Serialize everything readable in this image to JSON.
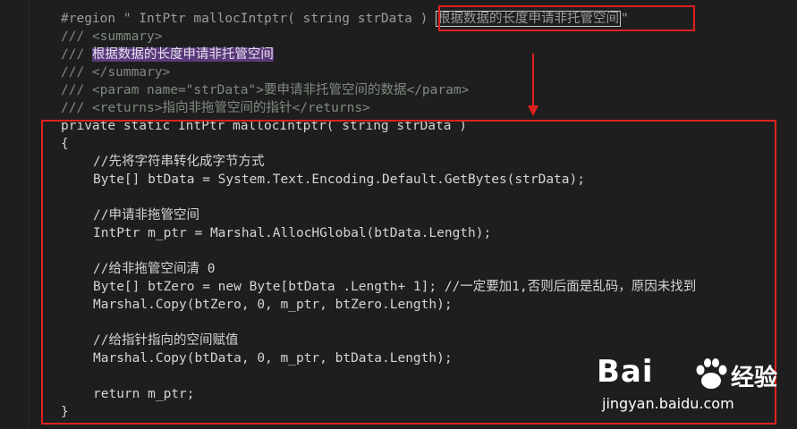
{
  "editor": {
    "lines": [
      {
        "segments": [
          {
            "t": "#region \" IntPtr mallocIntptr( string strData ) "
          },
          {
            "t": "根据数据的长度申请非托管空间",
            "boxed": true
          },
          {
            "t": "\""
          }
        ],
        "cls": "c-region"
      },
      {
        "segments": [
          {
            "t": "/// <summary>"
          }
        ],
        "cls": "c-doc"
      },
      {
        "segments": [
          {
            "t": "/// "
          },
          {
            "t": "根据数据的长度申请非托管空间",
            "hl": true
          }
        ],
        "cls": "c-doc"
      },
      {
        "segments": [
          {
            "t": "/// </summary>"
          }
        ],
        "cls": "c-doc"
      },
      {
        "segments": [
          {
            "t": "/// <param name=\"strData\">要申请非托管空间的数据</param>"
          }
        ],
        "cls": "c-doc"
      },
      {
        "segments": [
          {
            "t": "/// <returns>指向非拖管空间的指针</returns>"
          }
        ],
        "cls": "c-doc"
      },
      {
        "segments": [
          {
            "t": "private static IntPtr mallocIntptr( string strData )"
          }
        ],
        "cls": "c-code"
      },
      {
        "segments": [
          {
            "t": "{"
          }
        ],
        "cls": "c-code"
      },
      {
        "segments": [
          {
            "t": "//先将字符串转化成字节方式"
          }
        ],
        "cls": "c-cm",
        "ind": true
      },
      {
        "segments": [
          {
            "t": "Byte[] btData = System.Text.Encoding.Default.GetBytes(strData);"
          }
        ],
        "cls": "c-code",
        "ind": true
      },
      {
        "segments": [
          {
            "t": ""
          }
        ],
        "cls": "c-code"
      },
      {
        "segments": [
          {
            "t": "//申请非拖管空间"
          }
        ],
        "cls": "c-cm",
        "ind": true
      },
      {
        "segments": [
          {
            "t": "IntPtr m_ptr = Marshal.AllocHGlobal(btData.Length);"
          }
        ],
        "cls": "c-code",
        "ind": true
      },
      {
        "segments": [
          {
            "t": ""
          }
        ],
        "cls": "c-code"
      },
      {
        "segments": [
          {
            "t": "//给非拖管空间清 0"
          }
        ],
        "cls": "c-cm",
        "ind": true
      },
      {
        "segments": [
          {
            "t": "Byte[] btZero = new Byte[btData .Length+ 1]; //一定要加1,否则后面是乱码，原因未找到"
          }
        ],
        "cls": "c-code",
        "ind": true
      },
      {
        "segments": [
          {
            "t": "Marshal.Copy(btZero, 0, m_ptr, btZero.Length);"
          }
        ],
        "cls": "c-code",
        "ind": true
      },
      {
        "segments": [
          {
            "t": ""
          }
        ],
        "cls": "c-code"
      },
      {
        "segments": [
          {
            "t": "//给指针指向的空间赋值"
          }
        ],
        "cls": "c-cm",
        "ind": true
      },
      {
        "segments": [
          {
            "t": "Marshal.Copy(btData, 0, m_ptr, btData.Length);"
          }
        ],
        "cls": "c-code",
        "ind": true
      },
      {
        "segments": [
          {
            "t": ""
          }
        ],
        "cls": "c-code"
      },
      {
        "segments": [
          {
            "t": "return m_ptr;"
          }
        ],
        "cls": "c-code",
        "ind": true
      },
      {
        "segments": [
          {
            "t": "}"
          }
        ],
        "cls": "c-code"
      }
    ]
  },
  "watermark": {
    "brand": "Bai  经验",
    "brand_left": "Bai",
    "brand_right": "经验",
    "url": "jingyan.baidu.com"
  },
  "colors": {
    "annotation_red": "#e02020",
    "selection_purple": "#5a3a7a",
    "background": "#1e1e1e"
  }
}
